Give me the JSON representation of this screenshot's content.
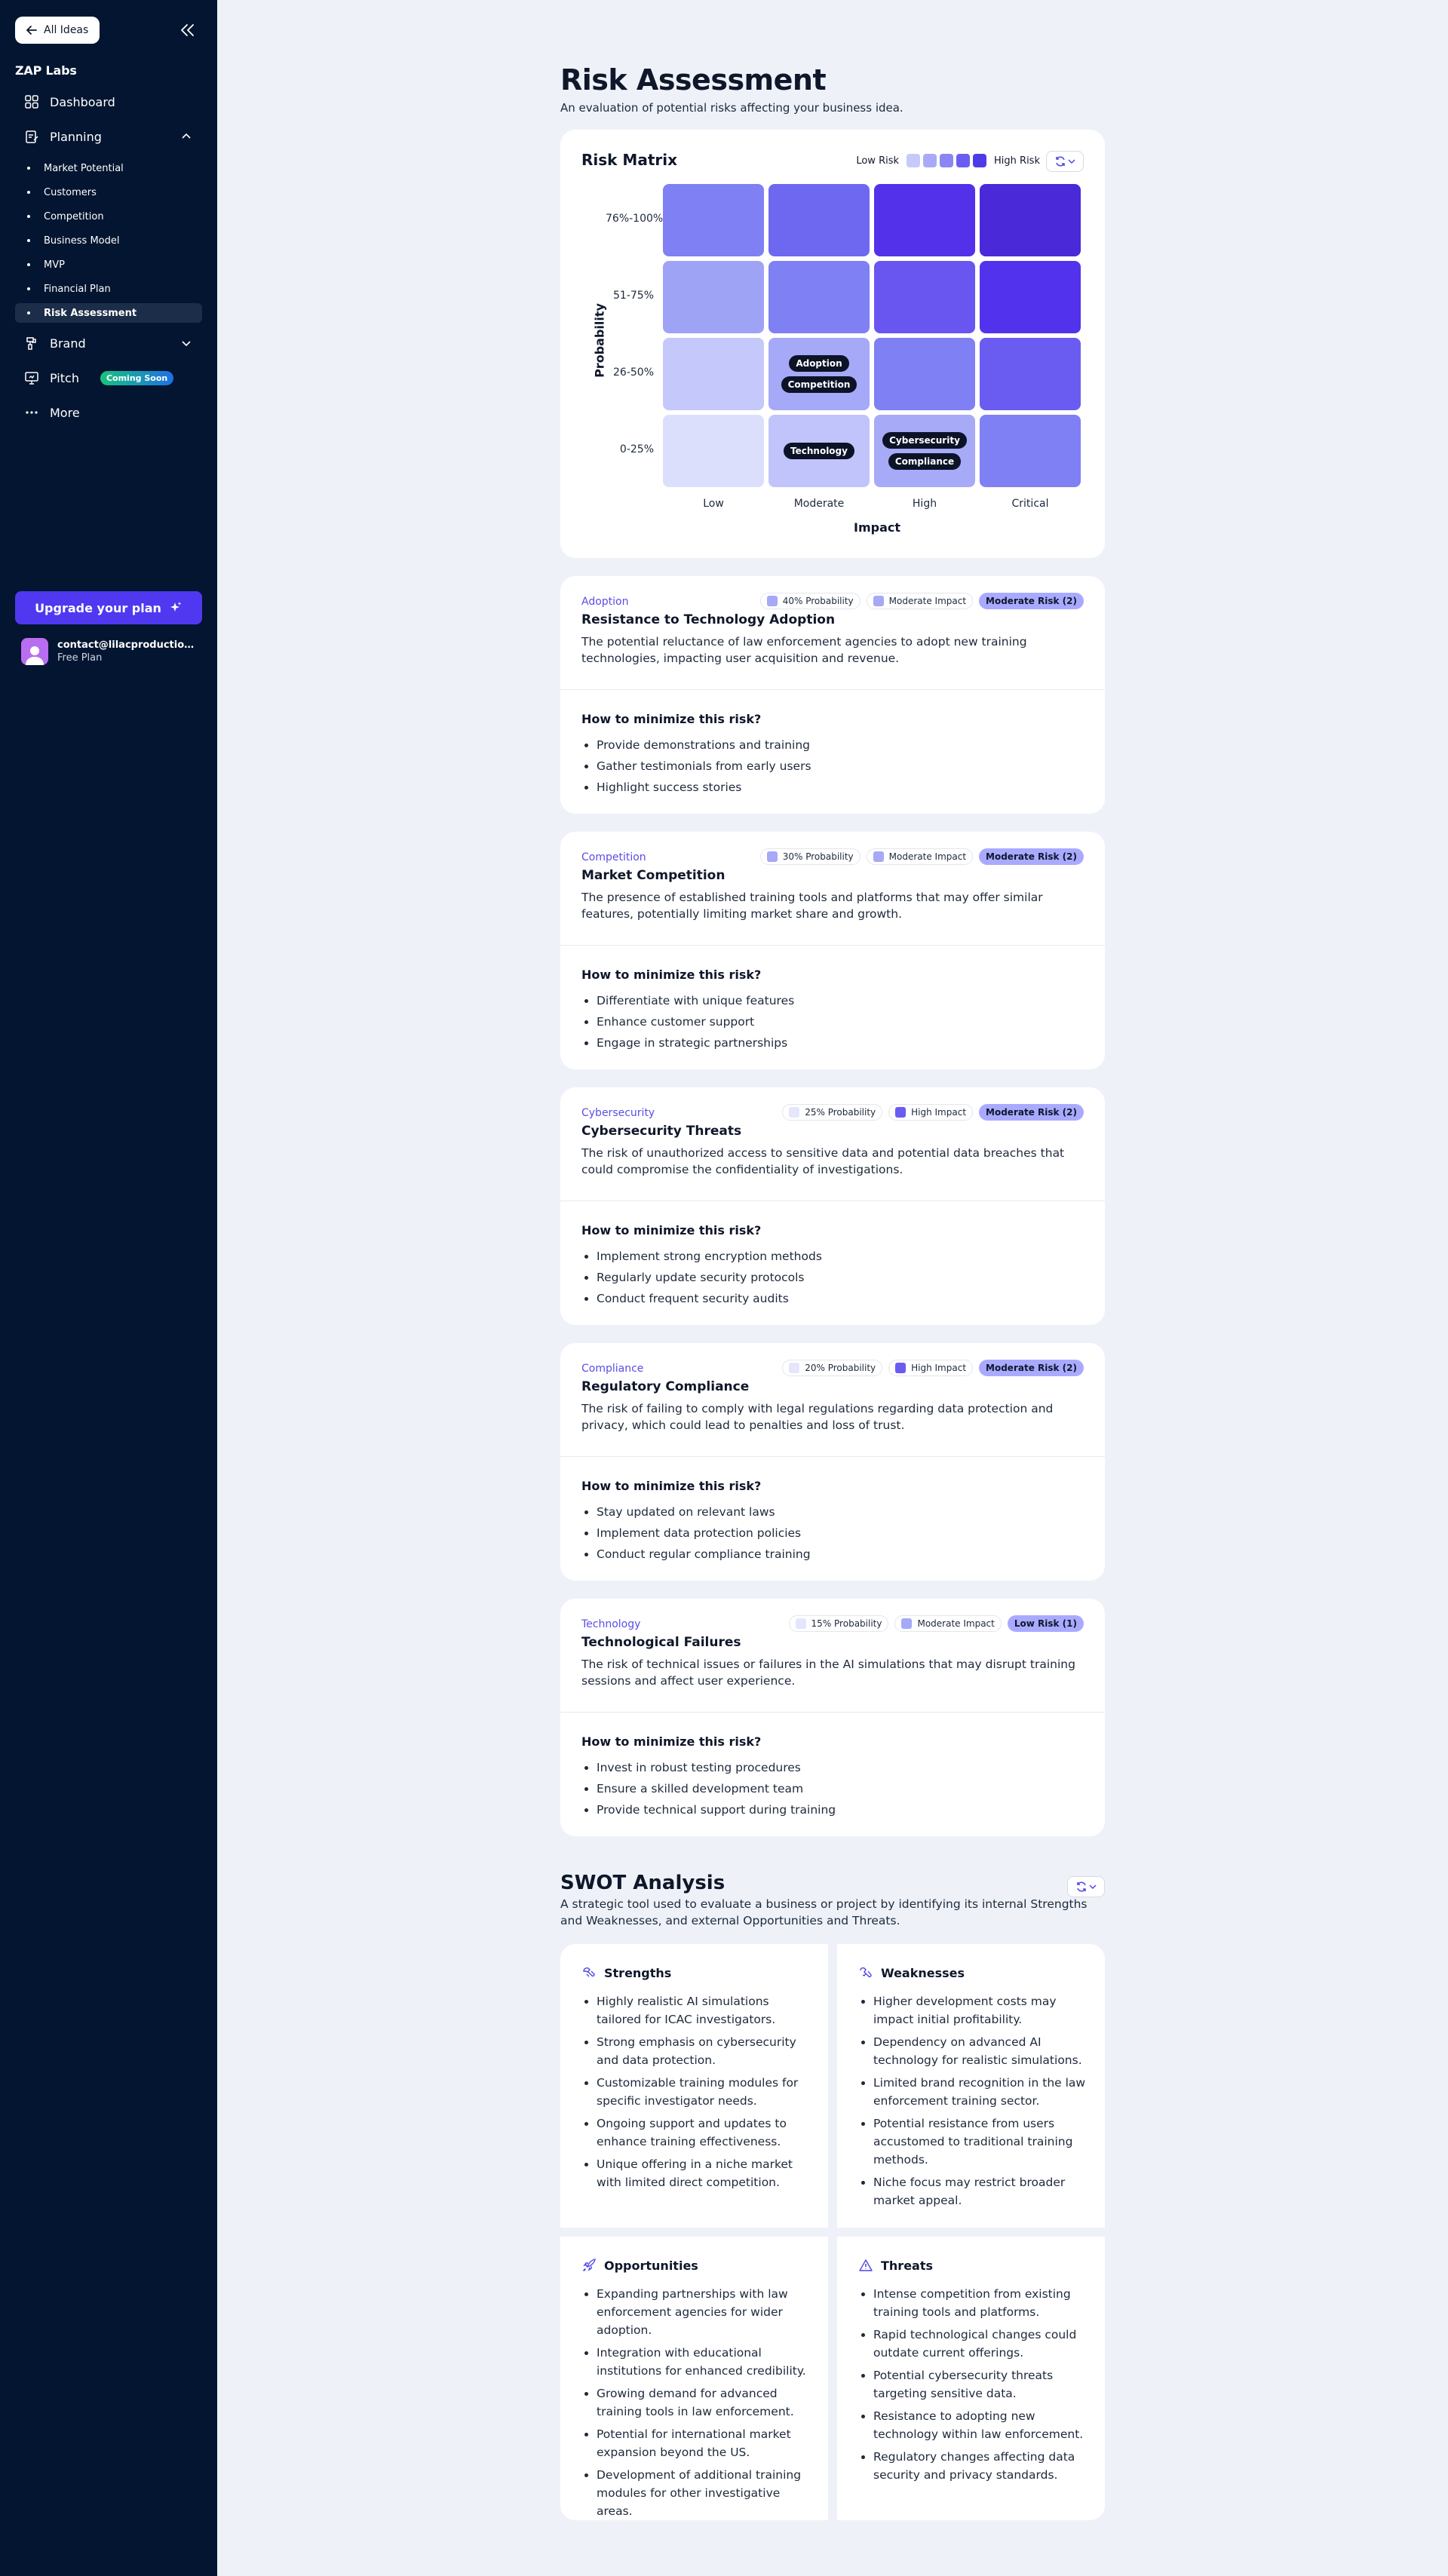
{
  "sidebar": {
    "back_label": "All Ideas",
    "org_name": "ZAP Labs",
    "nav": {
      "dashboard": "Dashboard",
      "planning": "Planning",
      "brand": "Brand",
      "pitch": "Pitch",
      "pitch_badge": "Coming Soon",
      "more": "More"
    },
    "planning_items": [
      "Market Potential",
      "Customers",
      "Competition",
      "Business Model",
      "MVP",
      "Financial Plan",
      "Risk Assessment"
    ],
    "upgrade_label": "Upgrade your plan",
    "user_email": "contact@lilacproductions.com",
    "user_plan": "Free Plan"
  },
  "page": {
    "title": "Risk Assessment",
    "subtitle": "An evaluation of potential risks affecting your business idea."
  },
  "matrix": {
    "title": "Risk Matrix",
    "legend_low": "Low Risk",
    "legend_high": "High Risk",
    "legend_colors": [
      "#c7c9fb",
      "#a9aaf7",
      "#8b86f5",
      "#6a5ef2",
      "#4e3be8"
    ],
    "y_axis_title": "Probability",
    "x_axis_title": "Impact",
    "y_labels": [
      "76%-100%",
      "51-75%",
      "26-50%",
      "0-25%"
    ],
    "x_labels": [
      "Low",
      "Moderate",
      "High",
      "Critical"
    ],
    "cell_colors": [
      [
        "#7f80f3",
        "#6e68f1",
        "#5331ea",
        "#4a29d8"
      ],
      [
        "#9fa3f6",
        "#7f80f3",
        "#6956f0",
        "#5332ed"
      ],
      [
        "#c5c8fb",
        "#a5a9f7",
        "#7f80f3",
        "#6a5cf1"
      ],
      [
        "#dcdffc",
        "#c1c4fa",
        "#a6aaf7",
        "#7f80f3"
      ]
    ],
    "cell_items": {
      "r2c1": [
        "Adoption",
        "Competition"
      ],
      "r3c1": [
        "Technology"
      ],
      "r3c2": [
        "Cybersecurity",
        "Compliance"
      ]
    }
  },
  "risks": [
    {
      "category": "Adoption",
      "title": "Resistance to Technology Adoption",
      "description": "The potential reluctance of law enforcement agencies to adopt new training technologies, impacting user acquisition and revenue.",
      "probability": "40% Probability",
      "probability_color": "#a5a9f7",
      "impact": "Moderate Impact",
      "impact_color": "#a5a9f7",
      "level": "Moderate Risk (2)",
      "how_title": "How to minimize this risk?",
      "mitigations": [
        "Provide demonstrations and training",
        "Gather testimonials from early users",
        "Highlight success stories"
      ]
    },
    {
      "category": "Competition",
      "title": "Market Competition",
      "description": "The presence of established training tools and platforms that may offer similar features, potentially limiting market share and growth.",
      "probability": "30% Probability",
      "probability_color": "#a5a9f7",
      "impact": "Moderate Impact",
      "impact_color": "#a5a9f7",
      "level": "Moderate Risk (2)",
      "how_title": "How to minimize this risk?",
      "mitigations": [
        "Differentiate with unique features",
        "Enhance customer support",
        "Engage in strategic partnerships"
      ]
    },
    {
      "category": "Cybersecurity",
      "title": "Cybersecurity Threats",
      "description": "The risk of unauthorized access to sensitive data and potential data breaches that could compromise the confidentiality of investigations.",
      "probability": "25% Probability",
      "probability_color": "#e4e6fd",
      "impact": "High Impact",
      "impact_color": "#6a5cf1",
      "level": "Moderate Risk (2)",
      "how_title": "How to minimize this risk?",
      "mitigations": [
        "Implement strong encryption methods",
        "Regularly update security protocols",
        "Conduct frequent security audits"
      ]
    },
    {
      "category": "Compliance",
      "title": "Regulatory Compliance",
      "description": "The risk of failing to comply with legal regulations regarding data protection and privacy, which could lead to penalties and loss of trust.",
      "probability": "20% Probability",
      "probability_color": "#e4e6fd",
      "impact": "High Impact",
      "impact_color": "#6a5cf1",
      "level": "Moderate Risk (2)",
      "how_title": "How to minimize this risk?",
      "mitigations": [
        "Stay updated on relevant laws",
        "Implement data protection policies",
        "Conduct regular compliance training"
      ]
    },
    {
      "category": "Technology",
      "title": "Technological Failures",
      "description": "The risk of technical issues or failures in the AI simulations that may disrupt training sessions and affect user experience.",
      "probability": "15% Probability",
      "probability_color": "#e4e6fd",
      "impact": "Moderate Impact",
      "impact_color": "#a5a9f7",
      "level": "Low Risk (1)",
      "how_title": "How to minimize this risk?",
      "mitigations": [
        "Invest in robust testing procedures",
        "Ensure a skilled development team",
        "Provide technical support during training"
      ]
    }
  ],
  "swot": {
    "title": "SWOT Analysis",
    "subtitle": "A strategic tool used to evaluate a business or project by identifying its internal Strengths and Weaknesses, and external Opportunities and Threats.",
    "strengths": {
      "title": "Strengths",
      "items": [
        "Highly realistic AI simulations tailored for ICAC investigators.",
        "Strong emphasis on cybersecurity and data protection.",
        "Customizable training modules for specific investigator needs.",
        "Ongoing support and updates to enhance training effectiveness.",
        "Unique offering in a niche market with limited direct competition."
      ]
    },
    "weaknesses": {
      "title": "Weaknesses",
      "items": [
        "Higher development costs may impact initial profitability.",
        "Dependency on advanced AI technology for realistic simulations.",
        "Limited brand recognition in the law enforcement training sector.",
        "Potential resistance from users accustomed to traditional training methods.",
        "Niche focus may restrict broader market appeal."
      ]
    },
    "opportunities": {
      "title": "Opportunities",
      "items": [
        "Expanding partnerships with law enforcement agencies for wider adoption.",
        "Integration with educational institutions for enhanced credibility.",
        "Growing demand for advanced training tools in law enforcement.",
        "Potential for international market expansion beyond the US.",
        "Development of additional training modules for other investigative areas."
      ]
    },
    "threats": {
      "title": "Threats",
      "items": [
        "Intense competition from existing training tools and platforms.",
        "Rapid technological changes could outdate current offerings.",
        "Potential cybersecurity threats targeting sensitive data.",
        "Resistance to adopting new technology within law enforcement.",
        "Regulatory changes affecting data security and privacy standards."
      ]
    }
  }
}
